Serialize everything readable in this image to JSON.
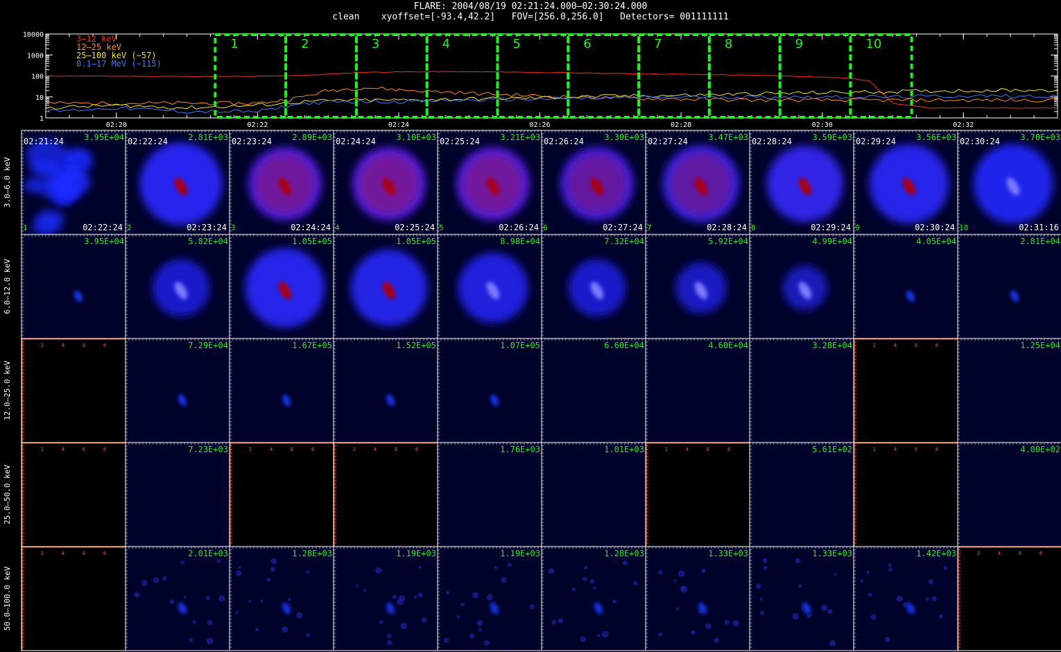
{
  "header": {
    "title": "FLARE: 2004/08/19 02:21:24.000–02:30:24.000",
    "subtitle": "clean    xyoffset=[-93.4,42.2]   FOV=[256.0,256.0]   Detectors= 001111111"
  },
  "lightcurve": {
    "chart_data": {
      "type": "line",
      "y_scale": "log",
      "ylim": [
        1,
        10000
      ],
      "y_ticks": [
        "1",
        "10",
        "100",
        "1000",
        "10000"
      ],
      "x_ticks": [
        "02:20",
        "02:22",
        "02:24",
        "02:26",
        "02:28",
        "02:30",
        "02:32"
      ],
      "xlim": [
        "02:19:00",
        "02:33:20"
      ],
      "series": [
        {
          "name": "3–12 keV",
          "color": "#ff2a1a",
          "x": [
            "02:19:00",
            "02:21:00",
            "02:22:00",
            "02:22:45",
            "02:23:30",
            "02:24:30",
            "02:25:30",
            "02:26:30",
            "02:27:30",
            "02:28:30",
            "02:29:30",
            "02:30:20",
            "02:30:40",
            "02:31:00",
            "02:31:30",
            "02:32:30",
            "02:33:20"
          ],
          "values": [
            100,
            95,
            95,
            110,
            150,
            160,
            155,
            140,
            125,
            115,
            100,
            80,
            60,
            5,
            3,
            3,
            3
          ]
        },
        {
          "name": "12–25 keV",
          "color": "#ff8c1a",
          "x": [
            "02:19:00",
            "02:21:00",
            "02:22:00",
            "02:22:30",
            "02:23:00",
            "02:23:30",
            "02:24:00",
            "02:25:00",
            "02:26:00",
            "02:27:00",
            "02:28:00",
            "02:29:00",
            "02:30:00",
            "02:31:00",
            "02:32:00",
            "02:33:20"
          ],
          "values": [
            5,
            5,
            5,
            8,
            20,
            28,
            22,
            15,
            11,
            9,
            8,
            7,
            7,
            7,
            7,
            7
          ]
        },
        {
          "name": "25–100 keV (−57)",
          "color": "#f0e028",
          "x": [
            "02:19:00",
            "02:20:00",
            "02:21:00",
            "02:22:00",
            "02:22:40",
            "02:23:20",
            "02:24:00",
            "02:25:00",
            "02:26:00",
            "02:27:00",
            "02:28:00",
            "02:29:00",
            "02:30:00",
            "02:31:00",
            "02:32:00",
            "02:33:20"
          ],
          "values": [
            3,
            4,
            3,
            4,
            6,
            7,
            7,
            8,
            9,
            11,
            12,
            14,
            16,
            18,
            20,
            22
          ]
        },
        {
          "name": "0.1–17 MeV (−115)",
          "color": "#3d78ff",
          "x": [
            "02:19:00",
            "02:20:00",
            "02:21:00",
            "02:22:00",
            "02:22:40",
            "02:23:20",
            "02:24:00",
            "02:25:00",
            "02:26:00",
            "02:27:00",
            "02:28:00",
            "02:29:00",
            "02:30:00",
            "02:31:00",
            "02:32:00",
            "02:33:20"
          ],
          "values": [
            2,
            3,
            2,
            2,
            5,
            6,
            6,
            7,
            8,
            9,
            10,
            10,
            10,
            10,
            11,
            11
          ]
        }
      ],
      "intervals": [
        {
          "label": "1",
          "start": "02:21:24",
          "end": "02:22:24"
        },
        {
          "label": "2",
          "start": "02:22:24",
          "end": "02:23:24"
        },
        {
          "label": "3",
          "start": "02:23:24",
          "end": "02:24:24"
        },
        {
          "label": "4",
          "start": "02:24:24",
          "end": "02:25:24"
        },
        {
          "label": "5",
          "start": "02:25:24",
          "end": "02:26:24"
        },
        {
          "label": "6",
          "start": "02:26:24",
          "end": "02:27:24"
        },
        {
          "label": "7",
          "start": "02:27:24",
          "end": "02:28:24"
        },
        {
          "label": "8",
          "start": "02:28:24",
          "end": "02:29:24"
        },
        {
          "label": "9",
          "start": "02:29:24",
          "end": "02:30:24"
        },
        {
          "label": "10",
          "start": "02:30:24",
          "end": "02:31:16"
        }
      ],
      "interval_color": "#22ee22"
    }
  },
  "grid": {
    "chart_data": {
      "type": "heatmap",
      "rows": [
        "3.0–6.0 keV",
        "6.0–12.0 keV",
        "12.0–25.0 keV",
        "25.0–50.0 keV",
        "50.0–100.0 keV"
      ],
      "columns": [
        {
          "index": "1",
          "start": "02:21:24",
          "end": "02:22:24"
        },
        {
          "index": "2",
          "start": "02:22:24",
          "end": "02:23:24"
        },
        {
          "index": "3",
          "start": "02:23:24",
          "end": "02:24:24"
        },
        {
          "index": "4",
          "start": "02:24:24",
          "end": "02:25:24"
        },
        {
          "index": "5",
          "start": "02:25:24",
          "end": "02:26:24"
        },
        {
          "index": "6",
          "start": "02:26:24",
          "end": "02:27:24"
        },
        {
          "index": "7",
          "start": "02:27:24",
          "end": "02:28:24"
        },
        {
          "index": "8",
          "start": "02:28:24",
          "end": "02:29:24"
        },
        {
          "index": "9",
          "start": "02:29:24",
          "end": "02:30:24"
        },
        {
          "index": "10",
          "start": "02:30:24",
          "end": "02:31:16"
        }
      ],
      "peak_values": [
        [
          "3.95E+04",
          "2.81E+03",
          "2.89E+03",
          "3.10E+03",
          "3.21E+03",
          "3.30E+03",
          "3.47E+03",
          "3.59E+03",
          "3.56E+03",
          "3.70E+03"
        ],
        [
          "3.95E+04",
          "5.82E+04",
          "1.05E+05",
          "1.05E+05",
          "8.98E+04",
          "7.32E+04",
          "5.92E+04",
          "4.99E+04",
          "4.05E+04",
          "2.81E+04"
        ],
        [
          "",
          "7.29E+04",
          "1.67E+05",
          "1.52E+05",
          "1.07E+05",
          "6.60E+04",
          "4.60E+04",
          "3.28E+04",
          "",
          "1.25E+04"
        ],
        [
          "",
          "7.23E+03",
          "",
          "",
          "1.76E+03",
          "1.01E+03",
          "",
          "5.61E+02",
          "",
          "4.00E+02"
        ],
        [
          "",
          "2.01E+03",
          "1.28E+03",
          "1.19E+03",
          "1.19E+03",
          "1.28E+03",
          "1.33E+03",
          "1.33E+03",
          "1.42E+03",
          ""
        ]
      ],
      "red_mid_fraction": [
        [
          0.0,
          0.12,
          0.55,
          0.62,
          0.58,
          0.4,
          0.32,
          0.25,
          0.15,
          0.05
        ],
        [
          0.0,
          0.0,
          0.12,
          0.1,
          0.05,
          0.0,
          0.0,
          0.0,
          0.0,
          0.0
        ],
        [
          0,
          0,
          0,
          0,
          0,
          0,
          0,
          0,
          0,
          0
        ],
        [
          0,
          0,
          0,
          0,
          0,
          0,
          0,
          0,
          0,
          0
        ],
        [
          0,
          0,
          0,
          0,
          0,
          0,
          0,
          0,
          0,
          0
        ]
      ],
      "blue_level": [
        [
          0.9,
          0.95,
          0.8,
          0.8,
          0.8,
          0.8,
          0.85,
          0.85,
          0.9,
          0.9
        ],
        [
          0.1,
          0.55,
          0.9,
          0.85,
          0.75,
          0.55,
          0.45,
          0.35,
          0.15,
          0.1
        ],
        [
          0.0,
          0.1,
          0.1,
          0.08,
          0.03,
          0.0,
          0.0,
          0.0,
          0.0,
          0.0
        ],
        [
          0,
          0,
          0,
          0,
          0,
          0,
          0,
          0,
          0,
          0
        ],
        [
          0,
          0.06,
          0.05,
          0.05,
          0.05,
          0.05,
          0.05,
          0.05,
          0.05,
          0
        ]
      ],
      "panel_state": [
        [
          "image",
          "image",
          "image",
          "image",
          "image",
          "image",
          "image",
          "image",
          "image",
          "image"
        ],
        [
          "image",
          "image",
          "image",
          "image",
          "image",
          "image",
          "image",
          "image",
          "image",
          "image"
        ],
        [
          "blank",
          "image",
          "image",
          "image",
          "image",
          "image",
          "image",
          "image",
          "blank",
          "image"
        ],
        [
          "blank",
          "image",
          "blank",
          "blank",
          "image",
          "image",
          "blank",
          "image",
          "blank",
          "image"
        ],
        [
          "blank",
          "image",
          "image",
          "image",
          "image",
          "image",
          "image",
          "image",
          "image",
          "blank"
        ]
      ],
      "blank_axis_ticks": [
        "2",
        "4",
        "6",
        "8"
      ],
      "blank_axis_color": "#ff5a1a",
      "peak_label_color": "#22ee22"
    }
  }
}
